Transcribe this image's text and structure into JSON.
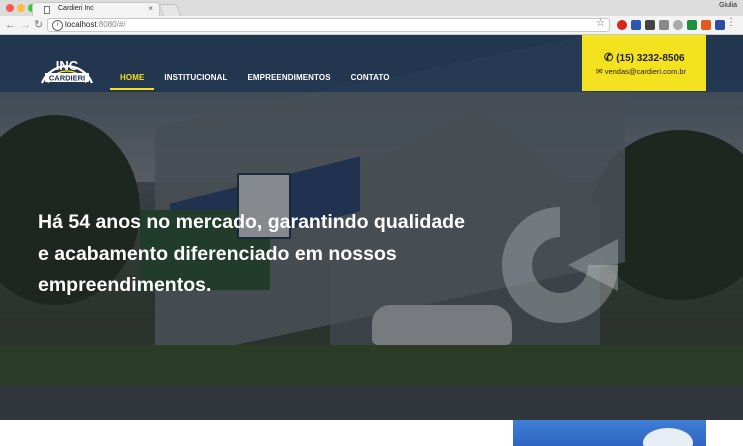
{
  "browser": {
    "tab_title": "Cardieri Inc",
    "tab_close": "×",
    "url_host": "localhost",
    "url_rest": ":8080/#/",
    "user_name": "Giulia",
    "back_icon": "back-arrow-icon",
    "forward_icon": "forward-arrow-icon",
    "reload_icon": "reload-icon",
    "extensions_count": 9
  },
  "site": {
    "logo_text_top": "INC",
    "logo_text_bottom": "CARDIERI",
    "nav": [
      {
        "label": "HOME",
        "active": true
      },
      {
        "label": "INSTITUCIONAL",
        "active": false
      },
      {
        "label": "EMPREENDIMENTOS",
        "active": false
      },
      {
        "label": "CONTATO",
        "active": false
      }
    ],
    "contact": {
      "phone": "(15) 3232-8506",
      "email": "vendas@cardieri.com.br"
    },
    "hero_headline": "Há 54 anos no mercado, garantindo qualidade e acabamento diferenciado em nossos empreendimentos."
  },
  "colors": {
    "header_bg": "#213650",
    "accent_yellow": "#f5e21e",
    "nav_active": "#f5df1e"
  }
}
